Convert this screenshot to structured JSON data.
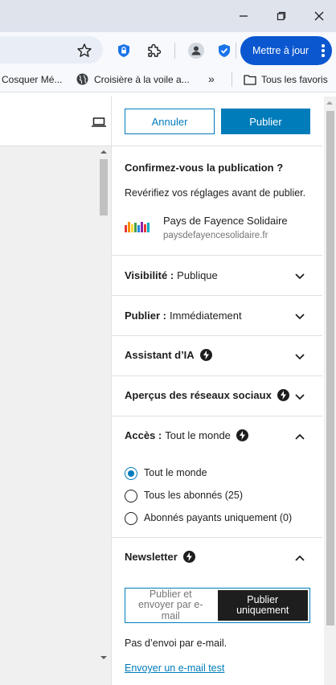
{
  "browser": {
    "update_button": "Mettre à jour",
    "bookmarks": [
      {
        "label": "Cosquer Mé..."
      },
      {
        "label": "Croisière à la voile a..."
      },
      {
        "label": "»"
      },
      {
        "label": "Tous les favoris"
      }
    ]
  },
  "panel": {
    "cancel_label": "Annuler",
    "publish_label": "Publier",
    "confirm_title": "Confirmez-vous la publication ?",
    "confirm_subtitle": "Revérifiez vos réglages avant de publier.",
    "site_name": "Pays de Fayence Solidaire",
    "site_url": "paysdefayencesolidaire.fr",
    "rows": {
      "visibility": {
        "label": "Visibilité :",
        "value": "Publique"
      },
      "publish": {
        "label": "Publier :",
        "value": "Immédiatement"
      },
      "ai": {
        "label": "Assistant d’IA"
      },
      "social": {
        "label": "Aperçus des réseaux sociaux"
      },
      "access": {
        "label": "Accès :",
        "value": "Tout le monde"
      },
      "newsletter": {
        "label": "Newsletter"
      }
    },
    "access_options": [
      {
        "label": "Tout le monde",
        "selected": true
      },
      {
        "label": "Tous les abonnés (25)",
        "selected": false
      },
      {
        "label": "Abonnés payants uniquement (0)",
        "selected": false
      }
    ],
    "newsletter_options": [
      {
        "label": "Publier et envoyer par e-mail",
        "selected": false
      },
      {
        "label": "Publier uniquement",
        "selected": true
      }
    ],
    "no_email_text": "Pas d’envoi par e-mail.",
    "test_email_link": "Envoyer un e-mail test"
  },
  "colors": {
    "accent": "#007cba",
    "browser_update": "#0b57d0",
    "dark": "#1e1e1e"
  }
}
